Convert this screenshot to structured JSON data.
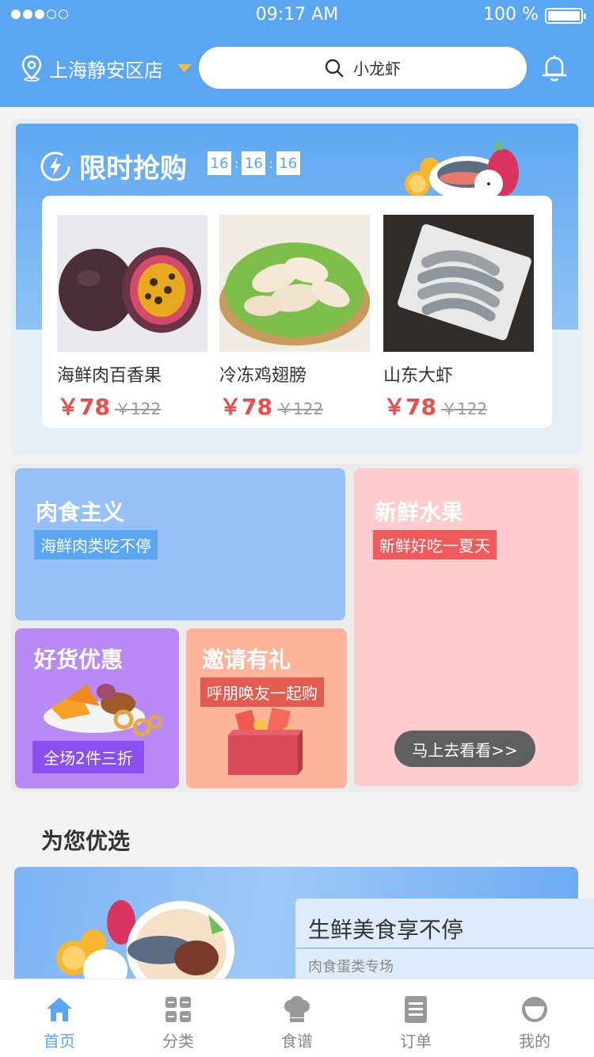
{
  "status_bar": {
    "time": "09:17 AM",
    "battery": "100 %"
  },
  "header": {
    "store": "上海静安区店",
    "search_placeholder": "小龙虾"
  },
  "flash_sale": {
    "title": "限时抢购",
    "countdown": [
      "16",
      "16",
      "16"
    ],
    "products": [
      {
        "name": "海鲜肉百香果",
        "price": "￥78",
        "original": "￥122"
      },
      {
        "name": "冷冻鸡翅膀",
        "price": "￥78",
        "original": "￥122"
      },
      {
        "name": "山东大虾",
        "price": "￥78",
        "original": "￥122"
      }
    ]
  },
  "tiles": {
    "meat": {
      "title": "肉食主义",
      "tag": "海鲜肉类吃不停"
    },
    "fruit": {
      "title": "新鲜水果",
      "tag": "新鲜好吃一夏天",
      "button": "马上去看看>>"
    },
    "deals": {
      "title": "好货优惠",
      "tag": "全场2件三折"
    },
    "invite": {
      "title": "邀请有礼",
      "tag": "呼朋唤友一起购"
    }
  },
  "recommend": {
    "title": "为您优选",
    "banner_title": "生鲜美食享不停",
    "banner_sub": "肉食蛋类专场"
  },
  "tabs": [
    {
      "label": "首页",
      "icon": "home-icon",
      "active": true
    },
    {
      "label": "分类",
      "icon": "category-icon",
      "active": false
    },
    {
      "label": "食谱",
      "icon": "chef-hat-icon",
      "active": false
    },
    {
      "label": "订单",
      "icon": "order-icon",
      "active": false
    },
    {
      "label": "我的",
      "icon": "profile-icon",
      "active": false
    }
  ],
  "colors": {
    "primary": "#5ba6f2",
    "price": "#ee4b4b"
  }
}
